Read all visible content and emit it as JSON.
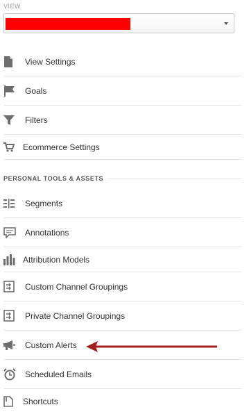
{
  "view": {
    "label": "VIEW",
    "selected_value": ""
  },
  "admin_items": [
    {
      "label": "View Settings",
      "icon": "document-icon"
    },
    {
      "label": "Goals",
      "icon": "flag-icon"
    },
    {
      "label": "Filters",
      "icon": "filter-icon"
    },
    {
      "label": "Ecommerce Settings",
      "icon": "cart-icon"
    }
  ],
  "personal_section": {
    "title": "PERSONAL TOOLS & ASSETS",
    "items": [
      {
        "label": "Segments",
        "icon": "segments-icon"
      },
      {
        "label": "Annotations",
        "icon": "comment-icon"
      },
      {
        "label": "Attribution Models",
        "icon": "bar-chart-icon"
      },
      {
        "label": "Custom Channel Groupings",
        "icon": "channel-grouping-icon"
      },
      {
        "label": "Private Channel Groupings",
        "icon": "channel-grouping-icon"
      },
      {
        "label": "Custom Alerts",
        "icon": "megaphone-icon"
      },
      {
        "label": "Scheduled Emails",
        "icon": "alarm-clock-icon"
      },
      {
        "label": "Shortcuts",
        "icon": "shortcut-icon"
      }
    ]
  },
  "annotation": {
    "arrow_color": "#a31f1f",
    "points_to": "Custom Alerts"
  },
  "colors": {
    "redaction": "#ff0000",
    "icon": "#6d6d6d",
    "divider": "#e5e5e5"
  }
}
